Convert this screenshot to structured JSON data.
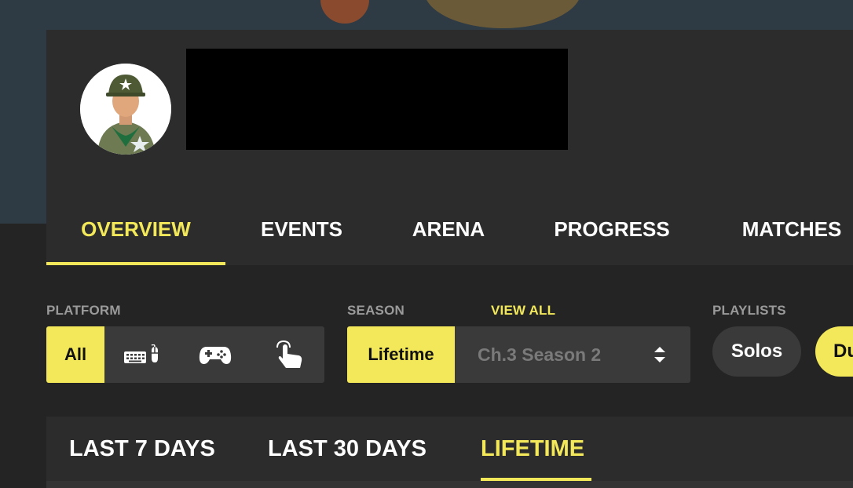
{
  "profile": {
    "avatar_icon": "soldier-avatar-icon"
  },
  "tabs": [
    {
      "label": "OVERVIEW",
      "active": true
    },
    {
      "label": "EVENTS",
      "active": false
    },
    {
      "label": "ARENA",
      "active": false
    },
    {
      "label": "PROGRESS",
      "active": false
    },
    {
      "label": "MATCHES",
      "active": false
    }
  ],
  "filters": {
    "platform": {
      "label": "PLATFORM",
      "options": [
        {
          "label": "All",
          "selected": true
        },
        {
          "icon": "keyboard-mouse-icon"
        },
        {
          "icon": "gamepad-icon"
        },
        {
          "icon": "touch-icon"
        }
      ]
    },
    "season": {
      "label": "SEASON",
      "view_all": "VIEW ALL",
      "selected_button": "Lifetime",
      "select_value": "Ch.3 Season 2",
      "select_icon": "sort-arrows-icon"
    },
    "playlists": {
      "label": "PLAYLISTS",
      "options": [
        {
          "label": "Solos",
          "selected": false
        },
        {
          "label": "Duos",
          "selected": true
        }
      ]
    }
  },
  "time_range": {
    "tabs": [
      {
        "label": "LAST 7 DAYS",
        "active": false
      },
      {
        "label": "LAST 30 DAYS",
        "active": false
      },
      {
        "label": "LIFETIME",
        "active": true
      }
    ]
  },
  "colors": {
    "accent": "#f2e85a",
    "panel": "#2c2c2c",
    "background": "#242424"
  }
}
